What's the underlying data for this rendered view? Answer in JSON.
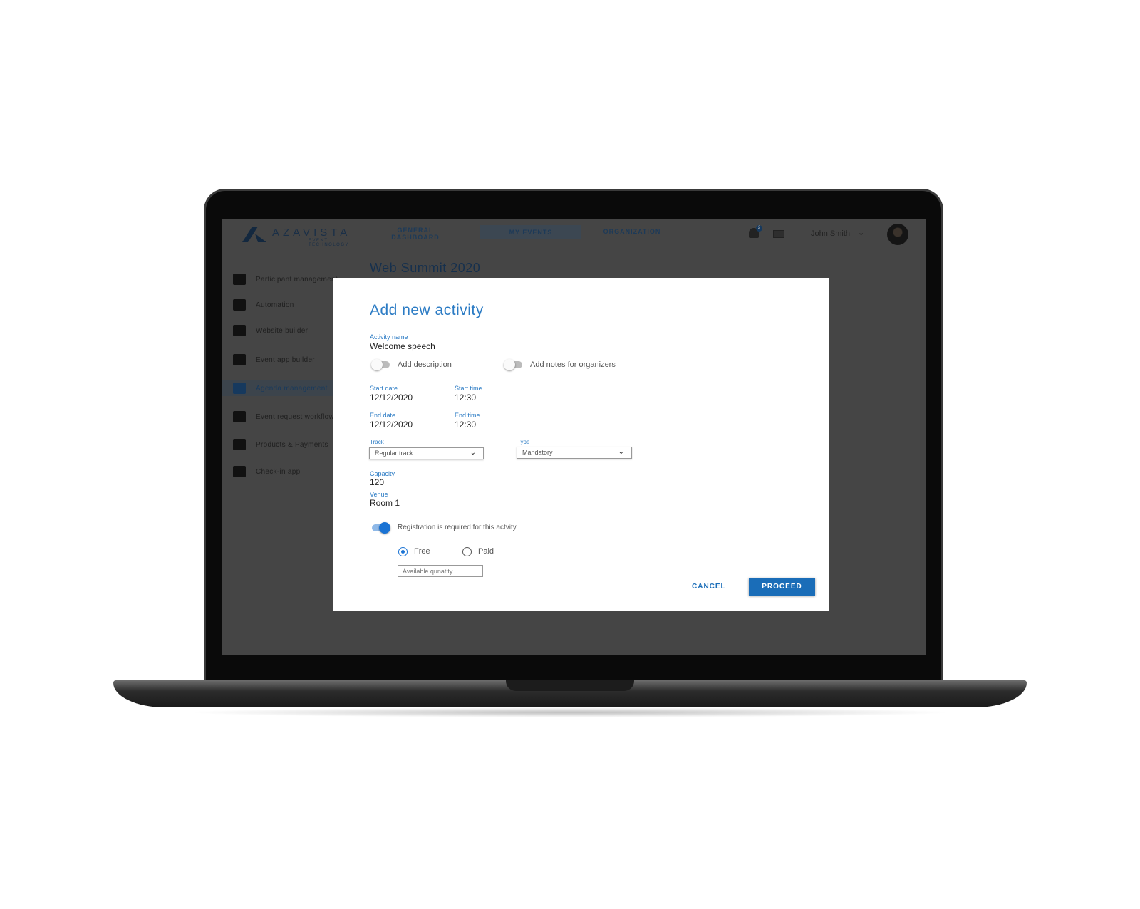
{
  "app": {
    "logo_text": "AZAVISTA",
    "logo_sub": "EVENT TECHNOLOGY",
    "brand_color": "#1e4f8a",
    "accent": "#1a6db8"
  },
  "nav": {
    "items": [
      {
        "label": "GENERAL DASHBOARD"
      },
      {
        "label": "MY EVENTS",
        "active": true
      },
      {
        "label": "ORGANIZATION"
      }
    ]
  },
  "header": {
    "notification_badge": "2",
    "user_name": "John Smith",
    "icons": [
      "bell-icon",
      "mail-icon",
      "chevron-down-icon",
      "avatar"
    ]
  },
  "page": {
    "title": "Web Summit 2020"
  },
  "sidebar": {
    "items": [
      {
        "label": "Participant management",
        "icon": "person-icon"
      },
      {
        "label": "Automation",
        "icon": "contact-card-icon"
      },
      {
        "label": "Website builder",
        "icon": "image-folder-icon"
      },
      {
        "label": "Event app builder",
        "icon": "phone-gear-icon"
      },
      {
        "label": "Agenda management",
        "icon": "calendar-icon",
        "active": true
      },
      {
        "label": "Event request workflow",
        "icon": "laptop-share-icon"
      },
      {
        "label": "Products & Payments",
        "icon": "credit-card-icon"
      },
      {
        "label": "Check-in app",
        "icon": "server-icon"
      }
    ]
  },
  "modal": {
    "title": "Add new activity",
    "activity_name": {
      "label": "Activity name",
      "value": "Welcome speech"
    },
    "toggle_description": {
      "label": "Add description",
      "on": false
    },
    "toggle_notes": {
      "label": "Add notes for organizers",
      "on": false
    },
    "start_date": {
      "label": "Start date",
      "value": "12/12/2020"
    },
    "start_time": {
      "label": "Start time",
      "value": "12:30"
    },
    "end_date": {
      "label": "End date",
      "value": "12/12/2020"
    },
    "end_time": {
      "label": "End time",
      "value": "12:30"
    },
    "track": {
      "label": "Track",
      "value": "Regular track"
    },
    "type": {
      "label": "Type",
      "value": "Mandatory"
    },
    "capacity": {
      "label": "Capacity",
      "value": "120"
    },
    "venue": {
      "label": "Venue",
      "value": "Room 1"
    },
    "registration": {
      "label": "Registration is required for this actvity",
      "on": true
    },
    "pricing": {
      "options": [
        "Free",
        "Paid"
      ],
      "selected": "Free"
    },
    "quantity": {
      "placeholder": "Available qunatity"
    },
    "cancel_label": "CANCEL",
    "proceed_label": "PROCEED"
  }
}
